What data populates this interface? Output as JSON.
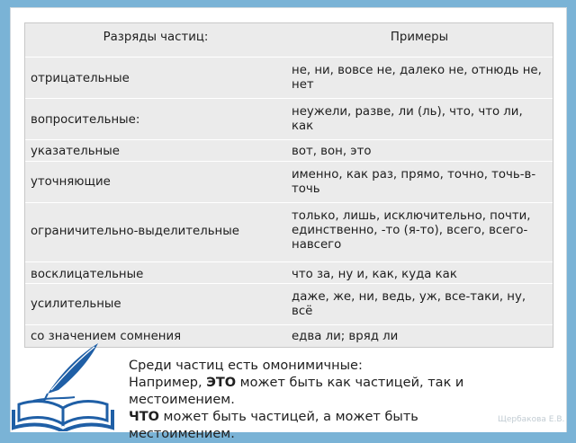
{
  "table": {
    "headers": [
      "Разряды частиц:",
      "Примеры"
    ],
    "rows": [
      {
        "category": "отрицательные",
        "examples": "не, ни, вовсе не, далеко не, отнюдь не, нет"
      },
      {
        "category": "вопросительные:",
        "examples": "неужели, разве, ли (ль), что, что ли, как"
      },
      {
        "category": "указательные",
        "examples": "вот, вон, это"
      },
      {
        "category": "уточняющие",
        "examples": "именно, как раз, прямо, точно, точь-в-точь"
      },
      {
        "category": "ограничительно-выделительные",
        "examples": "только, лишь, исключительно, почти, единственно, -то (я-то), всего, всего-навсего"
      },
      {
        "category": "восклицательные",
        "examples": "что за, ну и, как, куда как"
      },
      {
        "category": "усилительные",
        "examples": "даже, же, ни, ведь, уж, все-таки, ну, всё"
      },
      {
        "category": "со значением сомнения",
        "examples": "едва ли; вряд ли"
      }
    ]
  },
  "note": {
    "line1": "Среди частиц есть омонимичные:",
    "line2_pre": "Например, ",
    "line2_bold": "ЭТО",
    "line2_post": " может быть как частицей, так и местоимением.",
    "line3_bold": "ЧТО",
    "line3_post": " может быть частицей, а может быть местоимением."
  },
  "author": "Щербакова Е.В.",
  "icon": "book-quill-icon",
  "colors": {
    "background": "#7ab3d6",
    "table_bg": "#ebebeb",
    "icon_blue": "#1f5fa6"
  }
}
